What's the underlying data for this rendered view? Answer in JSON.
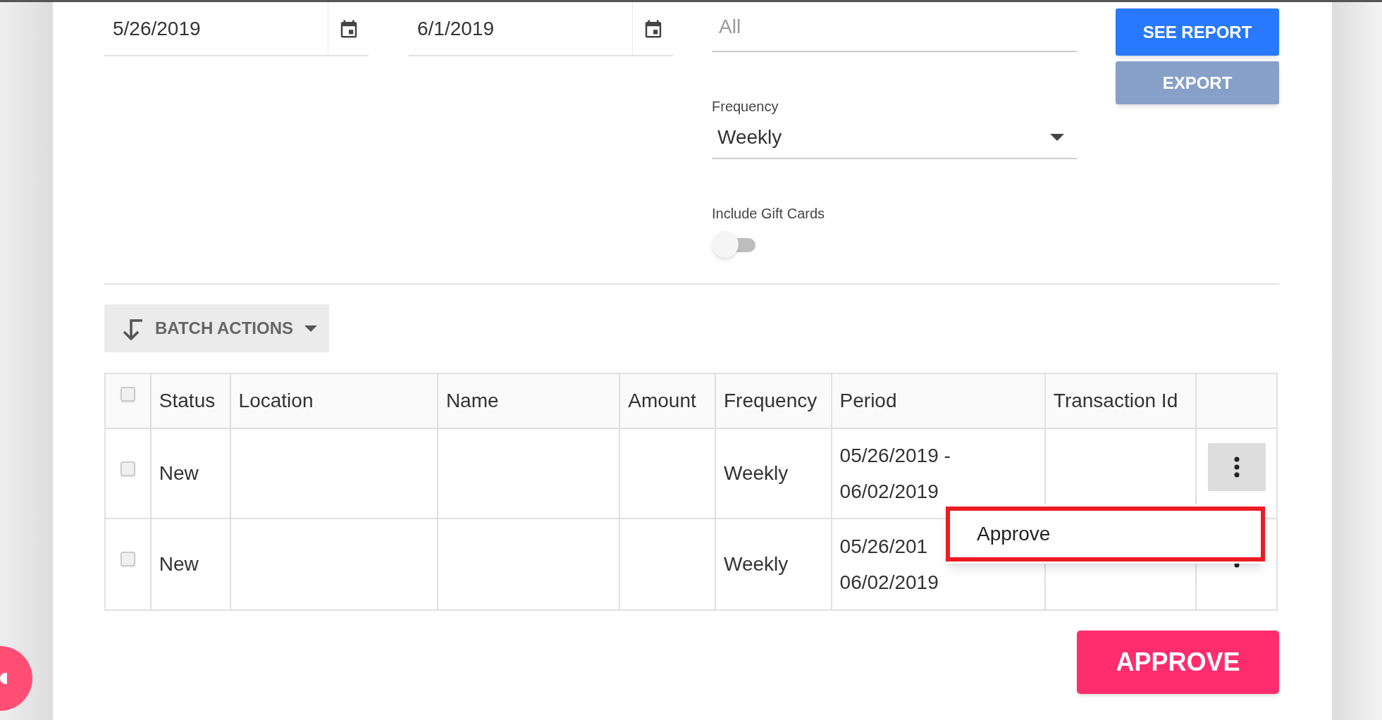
{
  "filters": {
    "start_date": {
      "value": "5/26/2019"
    },
    "end_date": {
      "value": "6/1/2019"
    },
    "locations": {
      "placeholder": "All"
    },
    "frequency": {
      "label": "Frequency",
      "value": "Weekly"
    },
    "gift_cards": {
      "label": "Include Gift Cards",
      "on": false
    }
  },
  "buttons": [
    {
      "label": "SEE REPORT",
      "disabled": false
    },
    {
      "label": "EXPORT",
      "disabled": true
    }
  ],
  "batch_actions": {
    "label": "BATCH ACTIONS"
  },
  "table": {
    "select_all": {
      "checked": false
    },
    "columns": [
      "Status",
      "Location",
      "Name",
      "Amount",
      "Frequency",
      "Period",
      "Transaction Id"
    ],
    "rows": [
      {
        "checked": false,
        "status": "New",
        "frequency": "Weekly",
        "period": [
          "05/26/2019 -",
          "06/02/2019"
        ],
        "menu_open": true
      },
      {
        "checked": false,
        "status": "New",
        "frequency": "Weekly",
        "period": [
          "05/26/201",
          "06/02/2019"
        ],
        "menu_open": false
      }
    ]
  },
  "row_menu": {
    "items": [
      {
        "label": "Approve",
        "highlighted": true
      }
    ]
  },
  "approve_button": {
    "label": "APPROVE"
  }
}
